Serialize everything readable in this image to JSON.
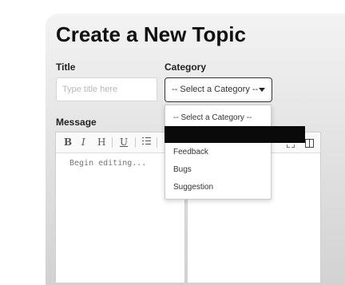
{
  "page": {
    "title": "Create a New Topic"
  },
  "title_field": {
    "label": "Title",
    "placeholder": "Type title here"
  },
  "category_field": {
    "label": "Category",
    "selected": "-- Select a Category --"
  },
  "dropdown": {
    "options": [
      "-- Select a Category --",
      "",
      "Feedback",
      "Bugs",
      "Suggestion"
    ],
    "highlighted_index": 1
  },
  "message_field": {
    "label": "Message",
    "placeholder": "Begin editing..."
  },
  "toolbar": {
    "bold": "B",
    "italic": "I",
    "heading": "H",
    "underline": "U",
    "list_icon": "ordered-list-icon",
    "fullscreen_icon": "fullscreen-icon",
    "preview_icon": "side-by-side-icon"
  }
}
